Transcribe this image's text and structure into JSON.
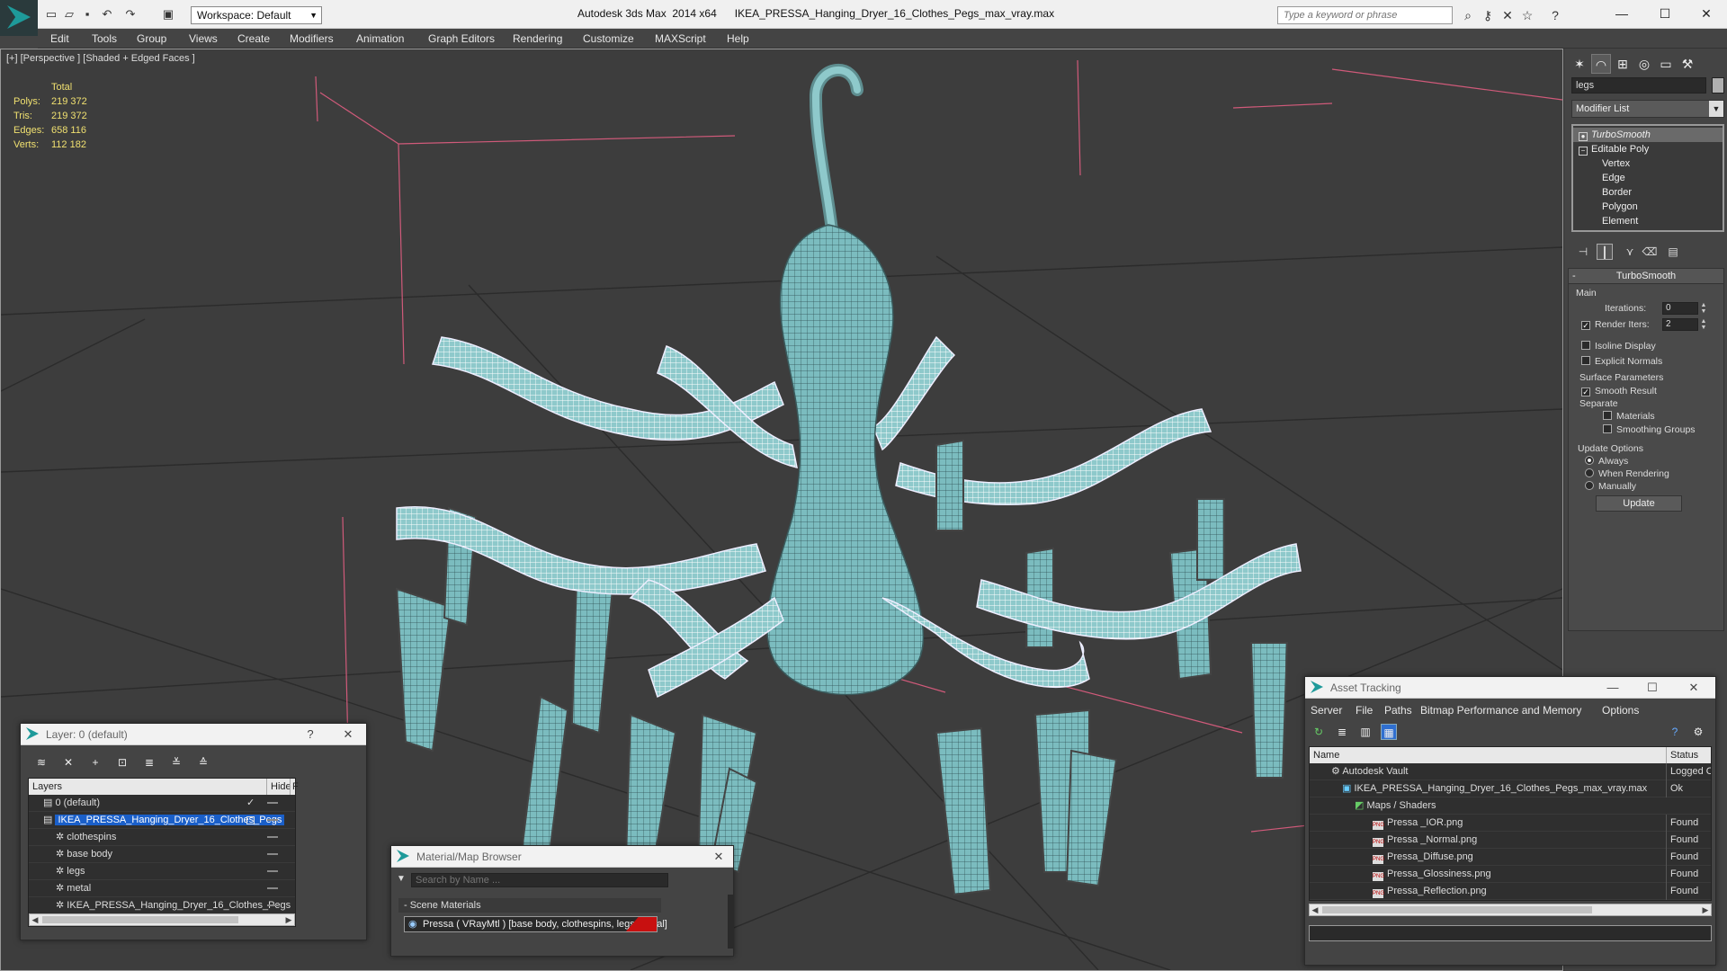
{
  "titlebar": {
    "app": "Autodesk 3ds Max  2014 x64",
    "file": "IKEA_PRESSA_Hanging_Dryer_16_Clothes_Pegs_max_vray.max",
    "workspace": "Workspace: Default",
    "search_placeholder": "Type a keyword or phrase"
  },
  "menus": [
    "Edit",
    "Tools",
    "Group",
    "Views",
    "Create",
    "Modifiers",
    "Animation",
    "Graph Editors",
    "Rendering",
    "Customize",
    "MAXScript",
    "Help"
  ],
  "viewport": {
    "label": "[+] [Perspective ] [Shaded + Edged Faces ]",
    "stats_header": "Total",
    "stats": [
      {
        "k": "Polys:",
        "v": "219 372"
      },
      {
        "k": "Tris:",
        "v": "219 372"
      },
      {
        "k": "Edges:",
        "v": "658 116"
      },
      {
        "k": "Verts:",
        "v": "112 182"
      }
    ],
    "model_color": "#7bbcbf"
  },
  "command_panel": {
    "object_name": "legs",
    "modifier_list": "Modifier List",
    "stack": [
      "TurboSmooth",
      "Editable Poly",
      "Vertex",
      "Edge",
      "Border",
      "Polygon",
      "Element"
    ],
    "rollout_title": "TurboSmooth",
    "main_label": "Main",
    "iterations_label": "Iterations:",
    "iterations_value": "0",
    "render_iters_label": "Render Iters:",
    "render_iters_value": "2",
    "isoline": "Isoline Display",
    "explicit_normals": "Explicit Normals",
    "surface_params": "Surface Parameters",
    "smooth_result": "Smooth Result",
    "separate": "Separate",
    "materials": "Materials",
    "smoothing_groups": "Smoothing Groups",
    "update_options": "Update Options",
    "always": "Always",
    "when_rendering": "When Rendering",
    "manually": "Manually",
    "update_btn": "Update"
  },
  "layer_window": {
    "title": "Layer: 0 (default)",
    "help": "?",
    "col_layers": "Layers",
    "col_hide": "Hide",
    "col_f": "F",
    "rows": [
      {
        "name": "0 (default)",
        "indent": 1
      },
      {
        "name": "IKEA_PRESSA_Hanging_Dryer_16_Clothes_Pegs",
        "indent": 1
      },
      {
        "name": "clothespins",
        "indent": 2
      },
      {
        "name": "base body",
        "indent": 2
      },
      {
        "name": "legs",
        "indent": 2
      },
      {
        "name": "metal",
        "indent": 2
      },
      {
        "name": "IKEA_PRESSA_Hanging_Dryer_16_Clothes_Pegs",
        "indent": 2
      }
    ]
  },
  "material_browser": {
    "title": "Material/Map Browser",
    "search_placeholder": "Search by Name ...",
    "group": "- Scene Materials",
    "material": "Pressa  ( VRayMtl )  [base body, clothespins, legs, metal]"
  },
  "asset_tracking": {
    "title": "Asset Tracking",
    "menus": [
      "Server",
      "File",
      "Paths",
      "Bitmap Performance and Memory",
      "Options"
    ],
    "col_name": "Name",
    "col_status": "Status",
    "rows": [
      {
        "name": "Autodesk Vault",
        "status": "Logged Out",
        "indent": 1
      },
      {
        "name": "IKEA_PRESSA_Hanging_Dryer_16_Clothes_Pegs_max_vray.max",
        "status": "Ok",
        "indent": 2
      },
      {
        "name": "Maps / Shaders",
        "status": "",
        "indent": 3
      },
      {
        "name": "Pressa _IOR.png",
        "status": "Found",
        "indent": 4
      },
      {
        "name": "Pressa _Normal.png",
        "status": "Found",
        "indent": 4
      },
      {
        "name": "Pressa_Diffuse.png",
        "status": "Found",
        "indent": 4
      },
      {
        "name": "Pressa_Glossiness.png",
        "status": "Found",
        "indent": 4
      },
      {
        "name": "Pressa_Reflection.png",
        "status": "Found",
        "indent": 4
      }
    ]
  }
}
